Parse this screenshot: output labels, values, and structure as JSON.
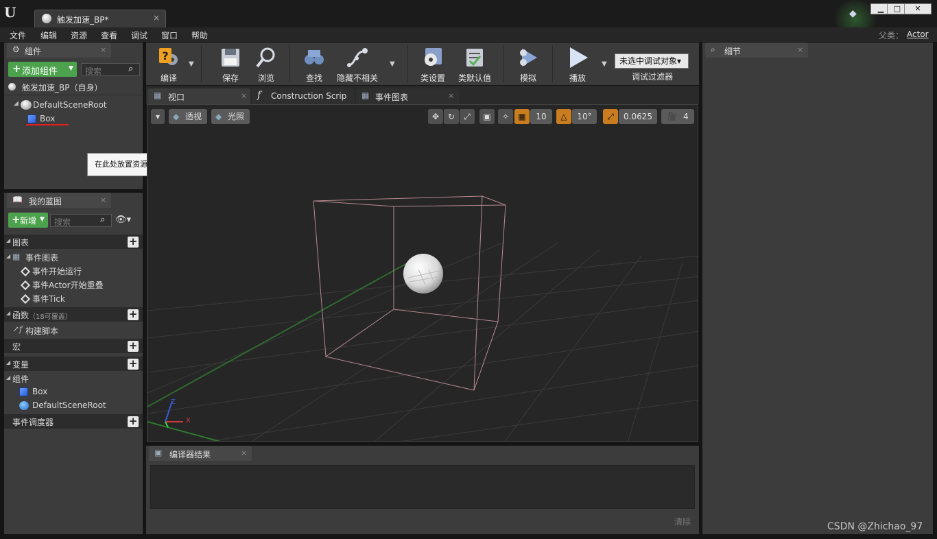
{
  "titlebar": {
    "tab_title": "触发加速_BP*",
    "tab_close": "×",
    "min_label": "▁",
    "max_label": "□",
    "close_label": "✕"
  },
  "menubar": {
    "items": [
      "文件",
      "编辑",
      "资源",
      "查看",
      "调试",
      "窗口",
      "帮助"
    ],
    "parent_class_label": "父类：",
    "parent_class_value": "Actor"
  },
  "components_panel": {
    "tab_label": "组件",
    "add_component_label": "添加组件",
    "search_placeholder": "搜索",
    "self_item": "触发加速_BP（自身）",
    "tree": [
      {
        "label": "DefaultSceneRoot"
      },
      {
        "label": "Box"
      }
    ],
    "tooltip": "在此处放置资源添加组件。"
  },
  "my_blueprint_panel": {
    "tab_label": "我的蓝图",
    "new_label": "新增",
    "search_placeholder": "搜索",
    "sections": {
      "graphs": "图表",
      "event_graph": "事件图表",
      "events": [
        "事件开始运行",
        "事件Actor开始重叠",
        "事件Tick"
      ],
      "functions": "函数",
      "functions_count": "（18可覆盖）",
      "construction_script": "构建脚本",
      "macros": "宏",
      "variables": "变量",
      "components": "组件",
      "component_items": [
        "Box",
        "DefaultSceneRoot"
      ],
      "event_dispatchers": "事件调度器"
    }
  },
  "toolbar": {
    "buttons": [
      {
        "label": "编译"
      },
      {
        "label": "保存"
      },
      {
        "label": "浏览"
      },
      {
        "label": "查找"
      },
      {
        "label": "隐藏不相关"
      },
      {
        "label": "类设置"
      },
      {
        "label": "类默认值"
      },
      {
        "label": "模拟"
      },
      {
        "label": "播放"
      }
    ],
    "debug_object": "未选中调试对象▾",
    "debug_filter": "调试过滤器"
  },
  "editor_tabs": [
    {
      "label": "视口"
    },
    {
      "label": "Construction Scrip"
    },
    {
      "label": "事件图表"
    }
  ],
  "viewport": {
    "perspective": "透视",
    "lit": "光照",
    "grid_snap": "10",
    "rot_snap": "10°",
    "scale_snap": "0.0625",
    "cam_speed": "4",
    "axis_x": "X",
    "axis_z": "Z"
  },
  "compiler_results": {
    "tab_label": "编译器结果",
    "clear_label": "清除"
  },
  "details_panel": {
    "tab_label": "细节"
  },
  "watermark": "CSDN @Zhichao_97",
  "colors": {
    "accent_green": "#4da34d",
    "orange_toggle": "#c97d1e",
    "bounds_line": "#b88a92",
    "selection_red": "#e02020"
  }
}
